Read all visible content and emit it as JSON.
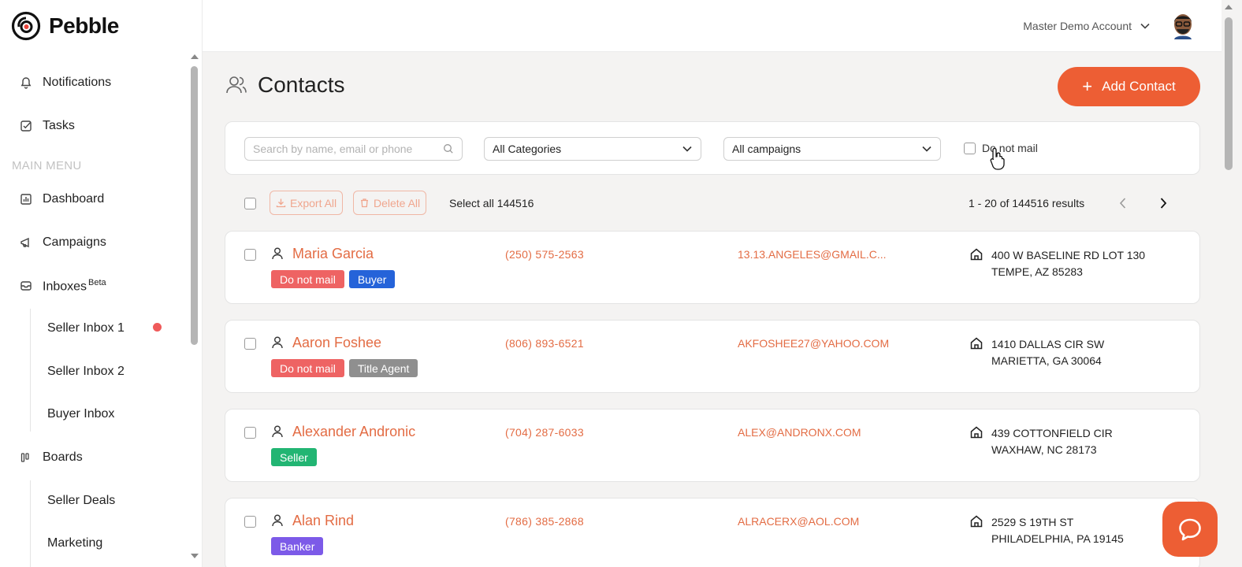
{
  "app": {
    "name": "Pebble"
  },
  "sidebar": {
    "top_items": [
      {
        "label": "Notifications",
        "icon": "bell-icon"
      },
      {
        "label": "Tasks",
        "icon": "task-check-icon"
      }
    ],
    "section_label": "MAIN MENU",
    "menu": [
      {
        "label": "Dashboard",
        "icon": "chart-icon"
      },
      {
        "label": "Campaigns",
        "icon": "megaphone-icon"
      },
      {
        "label": "Inboxes",
        "badge": "Beta",
        "icon": "inbox-icon"
      },
      {
        "label": "Boards",
        "icon": "board-icon"
      }
    ],
    "inboxes": [
      "Seller Inbox 1",
      "Seller Inbox 2",
      "Buyer Inbox"
    ],
    "boards": [
      "Seller Deals",
      "Marketing"
    ]
  },
  "header": {
    "account": "Master Demo Account"
  },
  "page": {
    "title": "Contacts",
    "add_button": "Add Contact"
  },
  "filters": {
    "search_placeholder": "Search by name, email or phone",
    "category": "All Categories",
    "campaign": "All campaigns",
    "do_not_mail_label": "Do not mail"
  },
  "toolbar": {
    "export_label": "Export All",
    "delete_label": "Delete All",
    "select_all": "Select all 144516",
    "results": "1 - 20 of 144516 results"
  },
  "contacts": [
    {
      "name": "Maria Garcia",
      "phone": "(250) 575-2563",
      "email": "13.13.ANGELES@GMAIL.C...",
      "address_line1": "400 W BASELINE RD LOT 130",
      "address_line2": "TEMPE, AZ 85283",
      "tags": [
        {
          "label": "Do not mail",
          "color": "#ee6363"
        },
        {
          "label": "Buyer",
          "color": "#2563d9"
        }
      ]
    },
    {
      "name": "Aaron Foshee",
      "phone": "(806) 893-6521",
      "email": "AKFOSHEE27@YAHOO.COM",
      "address_line1": "1410 DALLAS CIR SW",
      "address_line2": "MARIETTA, GA 30064",
      "tags": [
        {
          "label": "Do not mail",
          "color": "#ee6363"
        },
        {
          "label": "Title Agent",
          "color": "#8f8f8f"
        }
      ]
    },
    {
      "name": "Alexander Andronic",
      "phone": "(704) 287-6033",
      "email": "ALEX@ANDRONX.COM",
      "address_line1": "439 COTTONFIELD CIR",
      "address_line2": "WAXHAW, NC 28173",
      "tags": [
        {
          "label": "Seller",
          "color": "#22b573"
        }
      ]
    },
    {
      "name": "Alan Rind",
      "phone": "(786) 385-2868",
      "email": "ALRACERX@AOL.COM",
      "address_line1": "2529 S 19TH ST",
      "address_line2": "PHILADELPHIA, PA 19145",
      "tags": [
        {
          "label": "Banker",
          "color": "#7c5ae8"
        }
      ]
    }
  ],
  "colors": {
    "accent": "#ed5e34",
    "link": "#e36c44"
  }
}
